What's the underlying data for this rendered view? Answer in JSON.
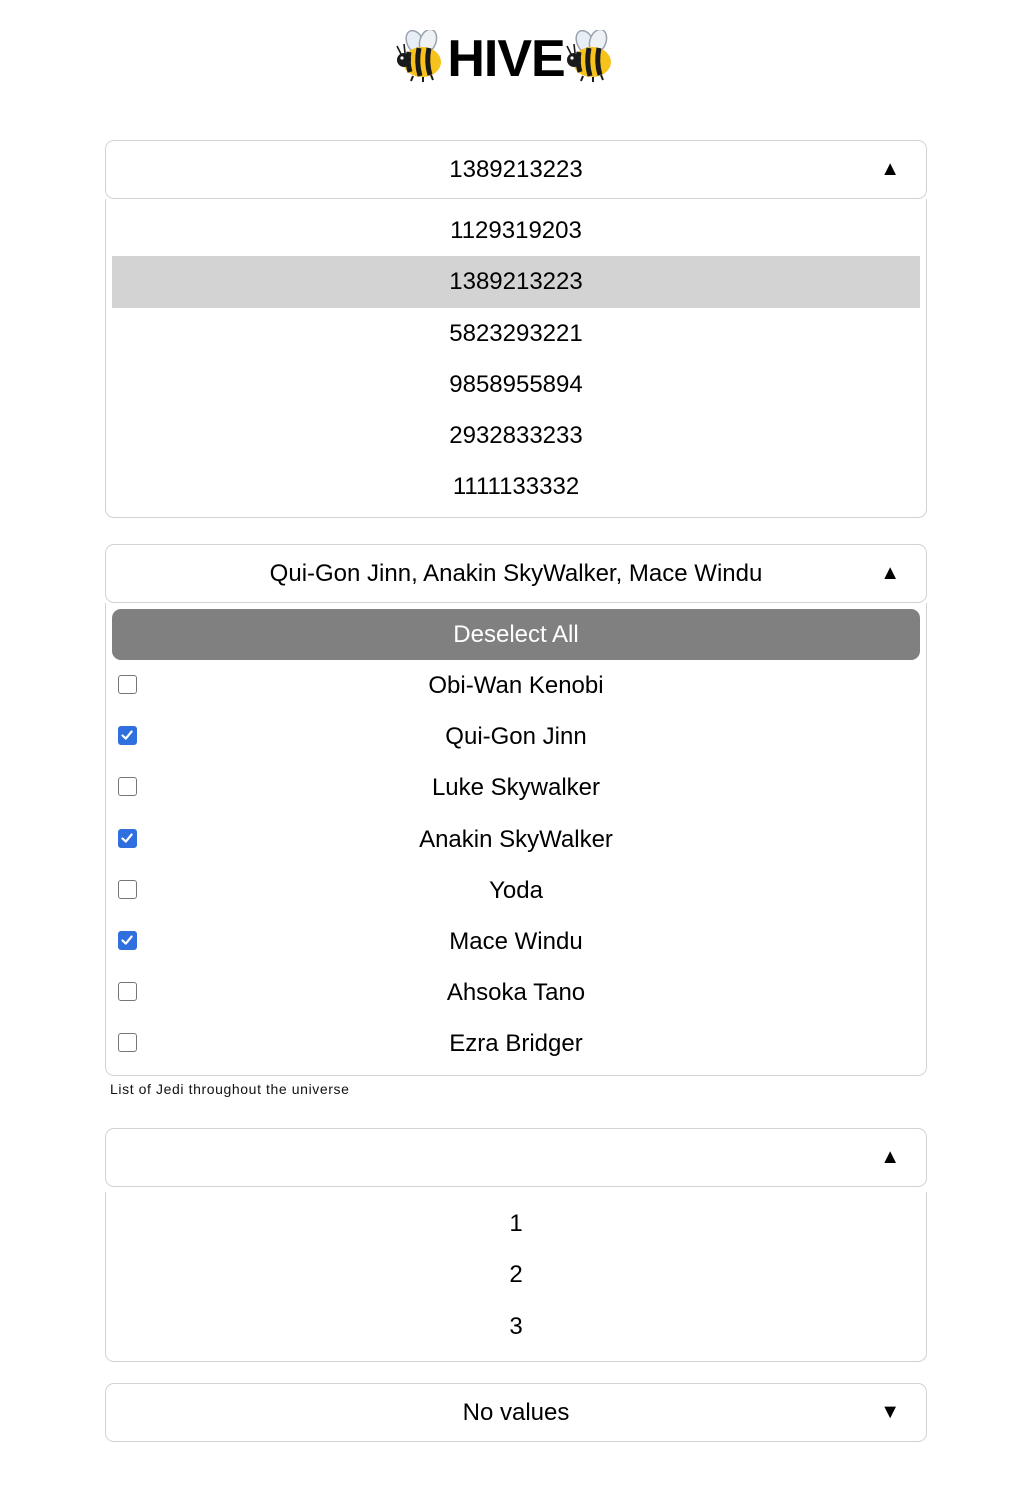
{
  "title": {
    "text": "HIVE",
    "icon": "bee-icon"
  },
  "number_dropdown": {
    "selected": "1389213223",
    "arrow": "▲",
    "options": [
      "1129319203",
      "1389213223",
      "5823293221",
      "9858955894",
      "2932833233",
      "1111133332"
    ],
    "selected_index": 1
  },
  "jedi_dropdown": {
    "selected": "Qui-Gon Jinn, Anakin SkyWalker, Mace Windu",
    "arrow": "▲",
    "deselect_label": "Deselect All",
    "options": [
      {
        "label": "Obi-Wan Kenobi",
        "checked": false
      },
      {
        "label": "Qui-Gon Jinn",
        "checked": true
      },
      {
        "label": "Luke Skywalker",
        "checked": false
      },
      {
        "label": "Anakin SkyWalker",
        "checked": true
      },
      {
        "label": "Yoda",
        "checked": false
      },
      {
        "label": "Mace Windu",
        "checked": true
      },
      {
        "label": "Ahsoka Tano",
        "checked": false
      },
      {
        "label": "Ezra Bridger",
        "checked": false
      }
    ],
    "caption": "List of Jedi throughout the universe"
  },
  "small_dropdown": {
    "selected": "",
    "arrow": "▲",
    "options": [
      "1",
      "2",
      "3"
    ]
  },
  "empty_dropdown": {
    "selected": "No values",
    "arrow": "▼"
  },
  "colors": {
    "checkbox_accent": "#2f6fde",
    "deselect_bg": "#808080",
    "selected_option_bg": "#d3d3d3",
    "border": "#d3d3d3"
  }
}
